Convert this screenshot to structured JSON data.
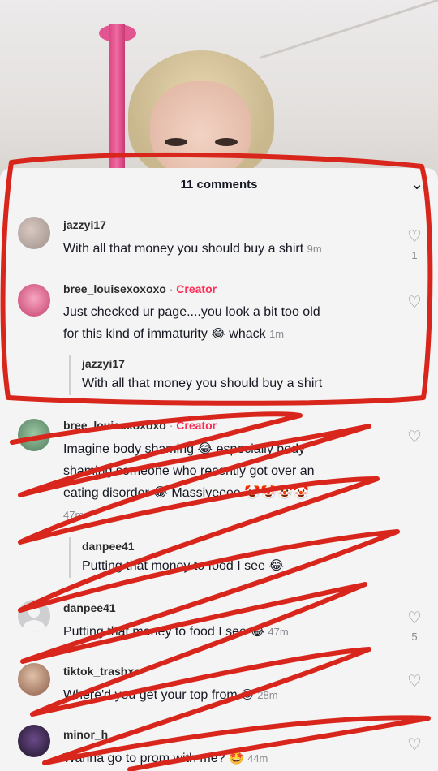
{
  "sheet": {
    "title": "11 comments",
    "close_icon": "chevron-down-icon"
  },
  "comments": [
    {
      "user": "jazzyi17",
      "text": "With all that money you should buy a shirt",
      "time": "9m",
      "likes": "1",
      "avatar_color": "#b9a8a0"
    },
    {
      "user": "bree_louisexoxoxo",
      "separator": "·",
      "badge": "Creator",
      "text_line1": "Just checked ur page....you look a bit too old",
      "text_line2_a": "for this kind of immaturity",
      "text_line2_emoji": "😂",
      "text_line2_b": "whack",
      "time": "1m",
      "avatar_color": "#e85a8a",
      "quote_user": "jazzyi17",
      "quote_text": "With all that money you should buy a shirt"
    },
    {
      "user": "bree_louisexoxoxo",
      "separator": "·",
      "badge": "Creator",
      "text_line1": "Imagine body shaming 😂 especially body",
      "text_line2": "shaming someone who recently got over an",
      "text_line3": "eating disorder 😂 Massiveeee 🤡🤡🤡🤡",
      "time": "47m",
      "quote_user": "danpee41",
      "quote_text": "Putting that money to food I see 😂"
    },
    {
      "user": "danpee41",
      "text": "Putting that money to food I see",
      "emoji": "😂",
      "time": "47m",
      "likes": "5",
      "avatar_color": "#cfcfd2"
    },
    {
      "user": "tiktok_trashxo",
      "text": "Where'd you get your top from",
      "emoji": "😍",
      "time": "28m",
      "avatar_color": "#b58a78"
    },
    {
      "user": "minor_h",
      "text": "Wanna go to prom with me?",
      "emoji": "🤩",
      "time": "44m",
      "avatar_color": "#3a2a4a"
    }
  ],
  "colors": {
    "scribble_red": "#d9261c",
    "creator_pink": "#fe2c55",
    "sheet_bg": "#f4f4f4"
  },
  "icons": {
    "like": "heart-outline-icon"
  }
}
